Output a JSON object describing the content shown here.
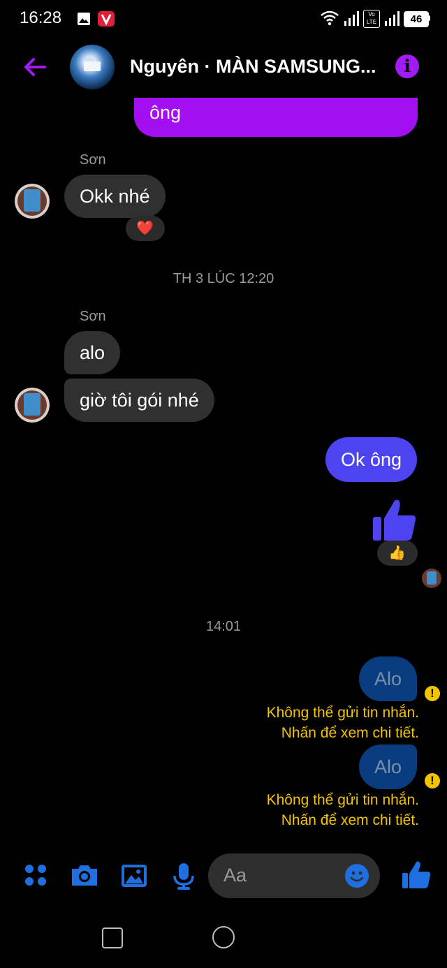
{
  "status_bar": {
    "time": "16:28",
    "battery": "46",
    "network_badge": "Vo LTE"
  },
  "header": {
    "title": "Nguyên · MÀN SAMSUNG...",
    "accent_color": "#a11bf5"
  },
  "messages": {
    "partial_outgoing": "ông",
    "sender_1": "Sơn",
    "msg_okk": "Okk nhé",
    "reaction_heart": "❤️",
    "timestamp_1": "TH 3 LÚC 12:20",
    "sender_2": "Sơn",
    "msg_alo": "alo",
    "msg_goi": "giờ tôi gói nhé",
    "msg_ok_ong": "Ok ông",
    "reaction_thumb": "👍",
    "timestamp_2": "14:01",
    "failed_1": "Alo",
    "failed_1_error_line1": "Không thể gửi tin nhắn.",
    "failed_1_error_line2": "Nhấn để xem chi tiết.",
    "failed_2": "Alo",
    "failed_2_error_line1": "Không thể gửi tin nhắn.",
    "failed_2_error_line2": "Nhấn để xem chi tiết."
  },
  "composer": {
    "placeholder": "Aa"
  },
  "colors": {
    "outgoing_purple": "#a30ff0",
    "outgoing_blue": "#4d44f0",
    "failed_bubble": "#0a3d80",
    "error_text": "#f3c400",
    "toolbar_blue": "#1f6fe0"
  }
}
